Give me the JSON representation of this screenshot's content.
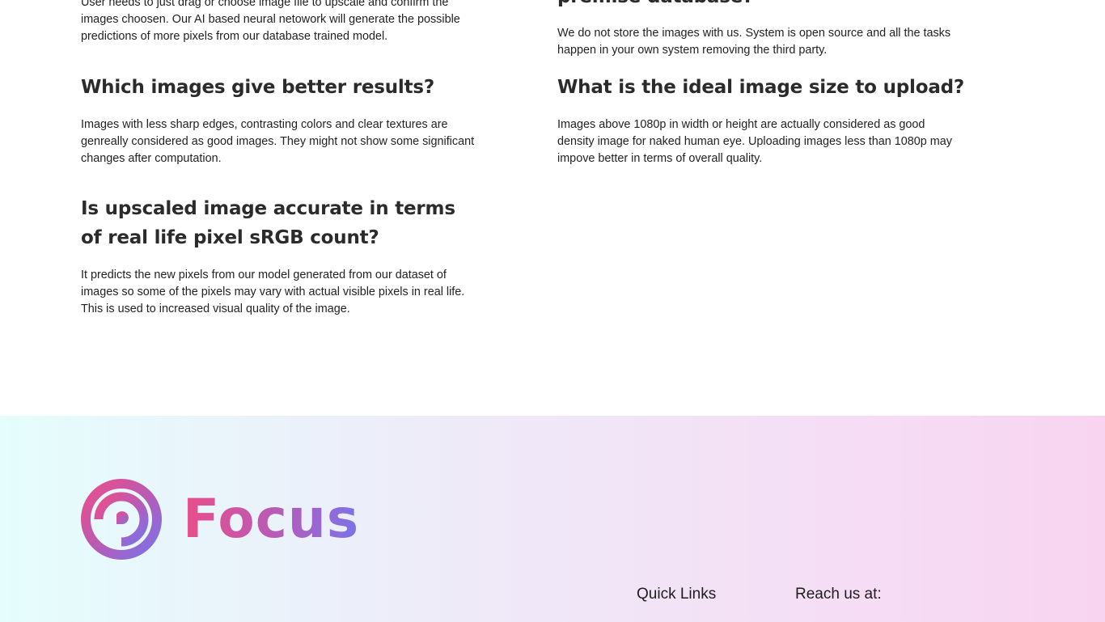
{
  "faq": {
    "left": [
      {
        "question": "",
        "answer": "User needs to just drag or choose image file to upscale and confirm the images choosen. Our AI based neural netowork will generate the possible predictions of more pixels from our database trained model."
      },
      {
        "question": "Which images give better results?",
        "answer": "Images with less sharp edges, contrasting colors and clear textures are genreally considered as good images. They might not show some significant changes after computation."
      },
      {
        "question": "Is upscaled image accurate in terms of real life pixel sRGB count?",
        "answer": "It predicts the new pixels from our model generated from our dataset of images so some of the pixels may vary with actual visible pixels in real life. This is used to increased visual quality of the image."
      }
    ],
    "right": [
      {
        "question": "premise database?",
        "answer": "We do not store the images with us. System is open source and all the tasks happen in your own system removing the third party."
      },
      {
        "question": "What is the ideal image size to upload?",
        "answer": "Images above 1080p in width or height are actually considered as good density image for naked human eye. Uploading images less than 1080p may impove better in terms of overall quality."
      }
    ]
  },
  "footer": {
    "logo_text": "Focus",
    "logo_icon": "focus-ring-logo-icon",
    "quick_links_heading": "Quick Links",
    "reach_us_heading": "Reach us at:",
    "gradient_start": "#e5fdfd",
    "gradient_end": "#f8d4f1",
    "brand_pink": "#ec4d8a",
    "brand_violet": "#7a73ea"
  }
}
